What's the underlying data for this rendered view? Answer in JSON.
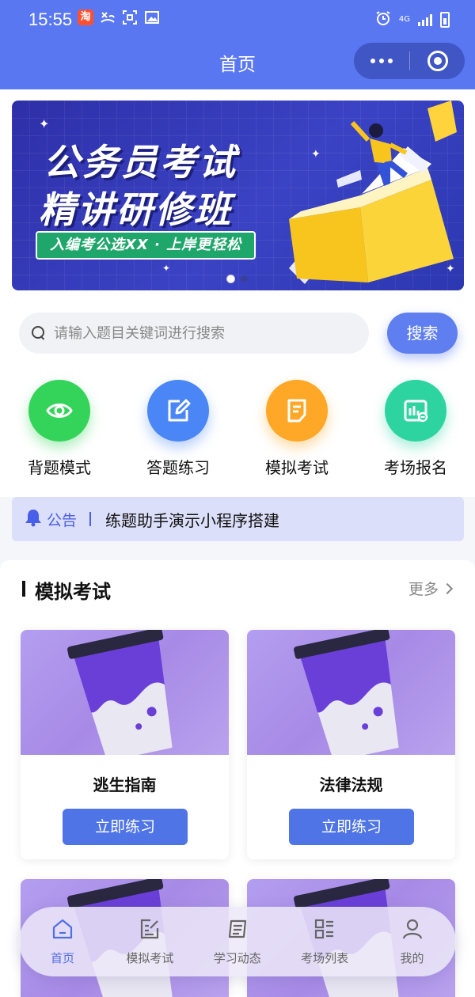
{
  "status_bar": {
    "time": "15:55",
    "network": "4G"
  },
  "header": {
    "title": "首页"
  },
  "banner": {
    "line1": "公务员考试",
    "line2": "精讲研修班",
    "tag": "入编考公选XX · 上岸更轻松",
    "pages": 2,
    "active_page": 1
  },
  "search": {
    "placeholder": "请输入题目关键词进行搜索",
    "value": "",
    "button_label": "搜索"
  },
  "shortcuts": [
    {
      "label": "背题模式",
      "icon": "eye-icon",
      "color": "#34d45a"
    },
    {
      "label": "答题练习",
      "icon": "edit-icon",
      "color": "#4a86f5"
    },
    {
      "label": "模拟考试",
      "icon": "document-icon",
      "color": "#ffa726"
    },
    {
      "label": "考场报名",
      "icon": "chart-board-icon",
      "color": "#2dd4a0"
    }
  ],
  "notice": {
    "label": "公告",
    "text": "练题助手演示小程序搭建"
  },
  "exam_section": {
    "title": "模拟考试",
    "more_label": "更多",
    "cards": [
      {
        "title": "逃生指南",
        "button_label": "立即练习"
      },
      {
        "title": "法律法规",
        "button_label": "立即练习"
      }
    ]
  },
  "tabbar": {
    "items": [
      {
        "label": "首页",
        "icon": "home-icon",
        "active": true
      },
      {
        "label": "模拟考试",
        "icon": "exam-icon",
        "active": false
      },
      {
        "label": "学习动态",
        "icon": "news-icon",
        "active": false
      },
      {
        "label": "考场列表",
        "icon": "list-icon",
        "active": false
      },
      {
        "label": "我的",
        "icon": "user-icon",
        "active": false
      }
    ]
  },
  "colors": {
    "primary": "#5a77f2",
    "notice_bg": "#dcdff9",
    "button": "#4f74e6"
  }
}
